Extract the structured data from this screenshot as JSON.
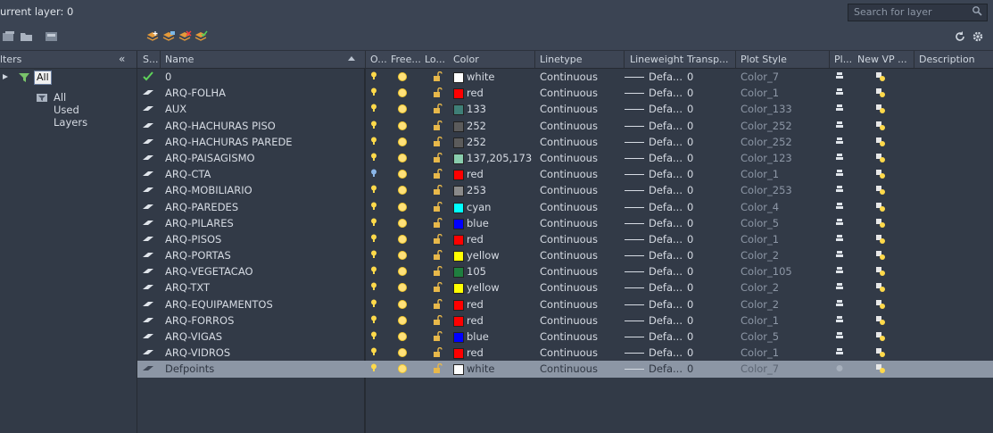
{
  "header": {
    "current_layer": "urrent layer: 0",
    "search_placeholder": "Search for layer"
  },
  "filters": {
    "title": "lters",
    "collapse": "«",
    "root": "All",
    "child": "All Used Layers"
  },
  "columns": {
    "status": "S...",
    "name": "Name",
    "on": "O...",
    "freeze": "Free...",
    "lock": "Lo...",
    "color": "Color",
    "linetype": "Linetype",
    "lineweight": "Lineweight",
    "transparency": "Transp...",
    "plot_style": "Plot Style",
    "plot": "Pl...",
    "new_vp": "New VP ...",
    "description": "Description"
  },
  "layers": [
    {
      "name": "0",
      "color_name": "white",
      "color_hex": "#ffffff",
      "linetype": "Continuous",
      "lineweight": "Defa...",
      "transparency": "0",
      "plot_style": "Color_7",
      "current": true
    },
    {
      "name": "ARQ-FOLHA",
      "color_name": "red",
      "color_hex": "#ff0000",
      "linetype": "Continuous",
      "lineweight": "Defa...",
      "transparency": "0",
      "plot_style": "Color_1"
    },
    {
      "name": "AUX",
      "color_name": "133",
      "color_hex": "#3f7f77",
      "linetype": "Continuous",
      "lineweight": "Defa...",
      "transparency": "0",
      "plot_style": "Color_133"
    },
    {
      "name": "ARQ-HACHURAS PISO",
      "color_name": "252",
      "color_hex": "#5b5b5b",
      "linetype": "Continuous",
      "lineweight": "Defa...",
      "transparency": "0",
      "plot_style": "Color_252"
    },
    {
      "name": "ARQ-HACHURAS PAREDE",
      "color_name": "252",
      "color_hex": "#5b5b5b",
      "linetype": "Continuous",
      "lineweight": "Defa...",
      "transparency": "0",
      "plot_style": "Color_252"
    },
    {
      "name": "ARQ-PAISAGISMO",
      "color_name": "137,205,173",
      "color_hex": "#89cdad",
      "linetype": "Continuous",
      "lineweight": "Defa...",
      "transparency": "0",
      "plot_style": "Color_123"
    },
    {
      "name": "ARQ-CTA",
      "color_name": "red",
      "color_hex": "#ff0000",
      "linetype": "Continuous",
      "lineweight": "Defa...",
      "transparency": "0",
      "plot_style": "Color_1",
      "bulb_off": true
    },
    {
      "name": "ARQ-MOBILIARIO",
      "color_name": "253",
      "color_hex": "#8a8a8a",
      "linetype": "Continuous",
      "lineweight": "Defa...",
      "transparency": "0",
      "plot_style": "Color_253"
    },
    {
      "name": "ARQ-PAREDES",
      "color_name": "cyan",
      "color_hex": "#00ffff",
      "linetype": "Continuous",
      "lineweight": "Defa...",
      "transparency": "0",
      "plot_style": "Color_4"
    },
    {
      "name": "ARQ-PILARES",
      "color_name": "blue",
      "color_hex": "#0000ff",
      "linetype": "Continuous",
      "lineweight": "Defa...",
      "transparency": "0",
      "plot_style": "Color_5"
    },
    {
      "name": "ARQ-PISOS",
      "color_name": "red",
      "color_hex": "#ff0000",
      "linetype": "Continuous",
      "lineweight": "Defa...",
      "transparency": "0",
      "plot_style": "Color_1"
    },
    {
      "name": "ARQ-PORTAS",
      "color_name": "yellow",
      "color_hex": "#ffff00",
      "linetype": "Continuous",
      "lineweight": "Defa...",
      "transparency": "0",
      "plot_style": "Color_2"
    },
    {
      "name": "ARQ-VEGETACAO",
      "color_name": "105",
      "color_hex": "#1f7f3f",
      "linetype": "Continuous",
      "lineweight": "Defa...",
      "transparency": "0",
      "plot_style": "Color_105"
    },
    {
      "name": "ARQ-TXT",
      "color_name": "yellow",
      "color_hex": "#ffff00",
      "linetype": "Continuous",
      "lineweight": "Defa...",
      "transparency": "0",
      "plot_style": "Color_2"
    },
    {
      "name": "ARQ-EQUIPAMENTOS",
      "color_name": "red",
      "color_hex": "#ff0000",
      "linetype": "Continuous",
      "lineweight": "Defa...",
      "transparency": "0",
      "plot_style": "Color_2"
    },
    {
      "name": "ARQ-FORROS",
      "color_name": "red",
      "color_hex": "#ff0000",
      "linetype": "Continuous",
      "lineweight": "Defa...",
      "transparency": "0",
      "plot_style": "Color_1"
    },
    {
      "name": "ARQ-VIGAS",
      "color_name": "blue",
      "color_hex": "#0000ff",
      "linetype": "Continuous",
      "lineweight": "Defa...",
      "transparency": "0",
      "plot_style": "Color_5"
    },
    {
      "name": "ARQ-VIDROS",
      "color_name": "red",
      "color_hex": "#ff0000",
      "linetype": "Continuous",
      "lineweight": "Defa...",
      "transparency": "0",
      "plot_style": "Color_1"
    },
    {
      "name": "Defpoints",
      "color_name": "white",
      "color_hex": "#ffffff",
      "linetype": "Continuous",
      "lineweight": "Defa...",
      "transparency": "0",
      "plot_style": "Color_7",
      "selected": true,
      "no_plot": true
    }
  ],
  "icons": {
    "current_status": "checkmark-icon",
    "layer_status": "layer-status-icon",
    "on": "lightbulb-icon",
    "freeze": "sun-icon",
    "lock": "unlock-icon",
    "plot": "printer-icon",
    "new_vp": "viewport-freeze-icon"
  }
}
